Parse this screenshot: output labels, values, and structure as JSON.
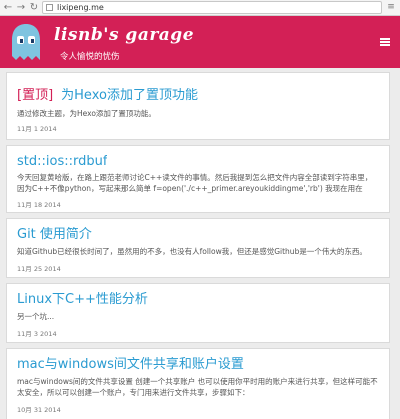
{
  "browser": {
    "url": "lixipeng.me",
    "back_icon": "arrow-left-icon",
    "forward_icon": "arrow-right-icon",
    "reload_icon": "reload-icon",
    "menu_icon": "menu-icon"
  },
  "header": {
    "title": "lisnb's garage",
    "subtitle": "令人愉悦的忧伤",
    "logo_icon": "ghost-icon",
    "menu_icon": "hamburger-icon",
    "color": "#d32056"
  },
  "posts": [
    {
      "pin_tag": "[置顶]",
      "title": "为Hexo添加了置顶功能",
      "excerpt": "通过修改主题，为Hexo添加了置顶功能。",
      "date": "11月 1 2014"
    },
    {
      "title": "std::ios::rdbuf",
      "excerpt": "今天回复黄哈版，在路上跟范老师讨论C++读文件的事情。然后我提到怎么把文件内容全部读到字符串里，因为C++不像python，写起来那么简单 f=open('./c++_primer.areyoukiddingme','rb') 我现在用在stackoverflow上查到的一个sn",
      "date": "11月 18 2014"
    },
    {
      "title": "Git 使用简介",
      "excerpt": "知道Github已经很长时间了，虽然用的不多，也没有人follow我，但还是感觉Github是一个伟大的东西。",
      "date": "11月 25 2014"
    },
    {
      "title": "Linux下C++性能分析",
      "excerpt": "另一个坑...",
      "date": "11月 3 2014"
    },
    {
      "title": "mac与windows间文件共享和账户设置",
      "excerpt": "mac与windows间的文件共享设置 创建一个共享账户 也可以使用你平时用的账户来进行共享，但这样可能不太安全，所以可以创建一个账户，专门用来进行文件共享，步骤如下：",
      "date": "10月 31 2014"
    }
  ]
}
